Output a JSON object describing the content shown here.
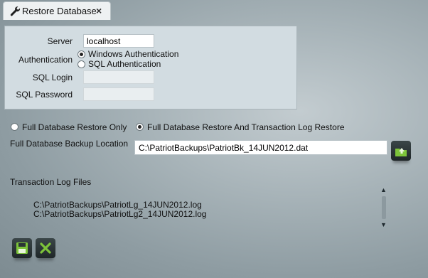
{
  "tab": {
    "title": "Restore Database",
    "close": "×",
    "icon": "wrench-icon"
  },
  "connection": {
    "server_label": "Server",
    "server_value": "localhost",
    "auth_label": "Authentication",
    "auth_options": [
      {
        "label": "Windows Authentication",
        "selected": true
      },
      {
        "label": "SQL Authentication",
        "selected": false
      }
    ],
    "login_label": "SQL Login",
    "login_value": "",
    "password_label": "SQL Password",
    "password_value": ""
  },
  "restore_mode": [
    {
      "label": "Full Database Restore Only",
      "selected": false
    },
    {
      "label": "Full Database Restore And Transaction Log Restore",
      "selected": true
    }
  ],
  "backup": {
    "label": "Full Database Backup Location",
    "value": "C:\\PatriotBackups\\PatriotBk_14JUN2012.dat",
    "browse_icon": "folder-open-icon"
  },
  "transaction_logs": {
    "title": "Transaction Log Files",
    "files": [
      "C:\\PatriotBackups\\PatriotLg_14JUN2012.log",
      "C:\\PatriotBackups\\PatriotLg2_14JUN2012.log"
    ]
  },
  "actions": {
    "save_icon": "save-icon",
    "cancel_icon": "close-icon"
  },
  "colors": {
    "icon_green": "#7dc43a",
    "button_dark": "#2a3335"
  }
}
